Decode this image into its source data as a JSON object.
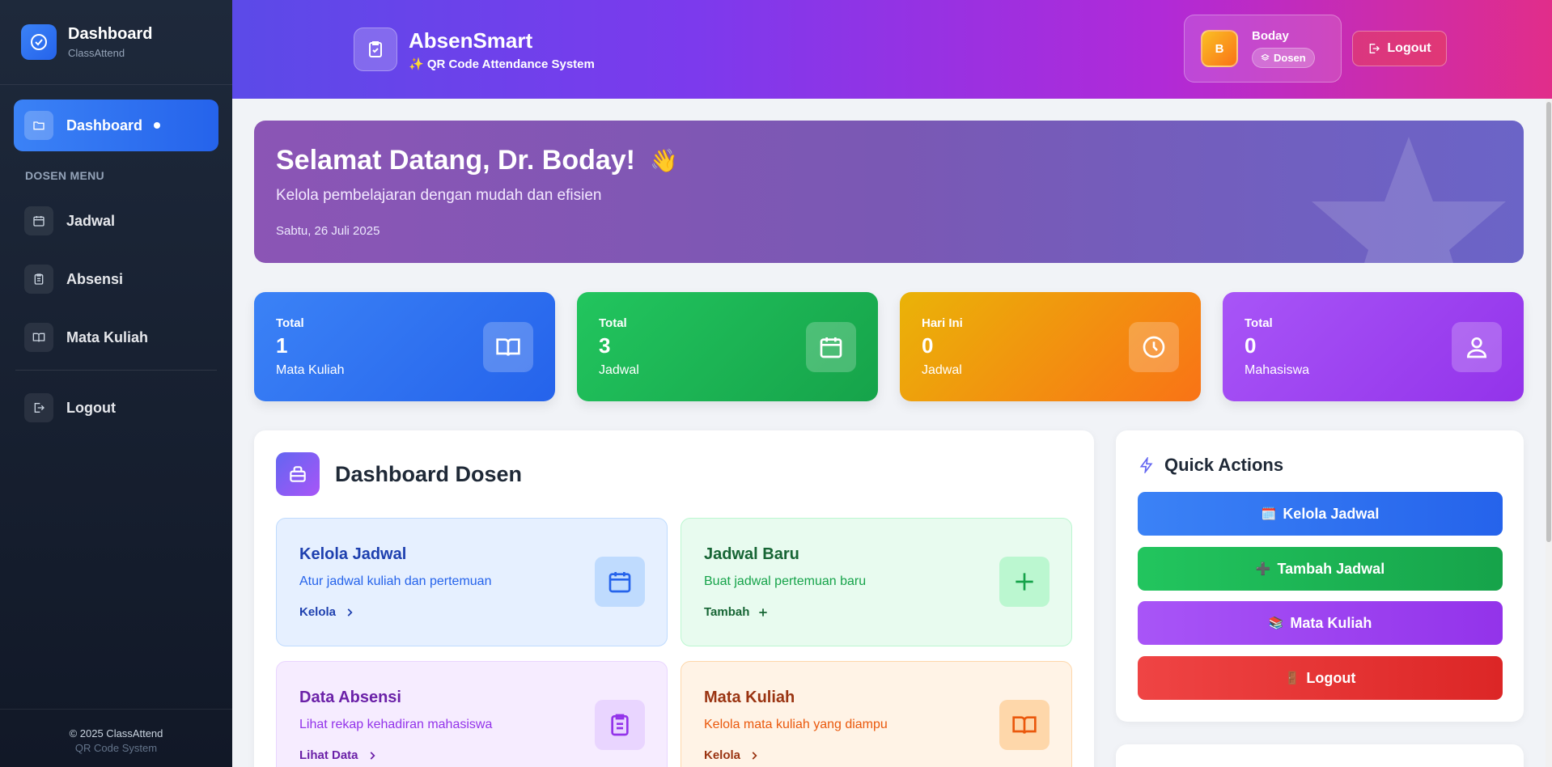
{
  "sidebar": {
    "title": "Dashboard",
    "subtitle": "ClassAttend",
    "active_item": "Dashboard",
    "section_label": "DOSEN MENU",
    "items": [
      {
        "label": "Jadwal",
        "icon": "calendar-icon"
      },
      {
        "label": "Absensi",
        "icon": "clipboard-icon"
      },
      {
        "label": "Mata Kuliah",
        "icon": "book-icon"
      }
    ],
    "logout_label": "Logout",
    "footer_copyright": "© 2025 ClassAttend",
    "footer_tagline": "QR Code System"
  },
  "header": {
    "app_name": "AbsenSmart",
    "app_tagline": "✨ QR Code Attendance System",
    "user": {
      "initial": "B",
      "name": "Boday",
      "role": "Dosen"
    },
    "logout_label": "Logout"
  },
  "welcome": {
    "title": "Selamat Datang, Dr. Boday!",
    "emoji": "👋",
    "subtitle": "Kelola pembelajaran dengan mudah dan efisien",
    "date": "Sabtu, 26 Juli 2025"
  },
  "stats": [
    {
      "caption": "Total",
      "value": "1",
      "unit": "Mata Kuliah",
      "icon": "book-icon",
      "color": "#3b82f6"
    },
    {
      "caption": "Total",
      "value": "3",
      "unit": "Jadwal",
      "icon": "calendar-icon",
      "color": "#22c55e"
    },
    {
      "caption": "Hari Ini",
      "value": "0",
      "unit": "Jadwal",
      "icon": "clock-icon",
      "color": "#f59e0b"
    },
    {
      "caption": "Total",
      "value": "0",
      "unit": "Mahasiswa",
      "icon": "user-icon",
      "color": "#a855f7"
    }
  ],
  "main": {
    "title": "Dashboard Dosen",
    "cards": [
      {
        "title": "Kelola Jadwal",
        "desc": "Atur jadwal kuliah dan pertemuan",
        "link": "Kelola"
      },
      {
        "title": "Jadwal Baru",
        "desc": "Buat jadwal pertemuan baru",
        "link": "Tambah"
      },
      {
        "title": "Data Absensi",
        "desc": "Lihat rekap kehadiran mahasiswa",
        "link": "Lihat Data"
      },
      {
        "title": "Mata Kuliah",
        "desc": "Kelola mata kuliah yang diampu",
        "link": "Kelola"
      }
    ]
  },
  "quick_actions": {
    "title": "Quick Actions",
    "buttons": [
      {
        "emoji": "🗓️",
        "label": "Kelola Jadwal"
      },
      {
        "emoji": "➕",
        "label": "Tambah Jadwal"
      },
      {
        "emoji": "📚",
        "label": "Mata Kuliah"
      },
      {
        "emoji": "🚪",
        "label": "Logout"
      }
    ]
  }
}
